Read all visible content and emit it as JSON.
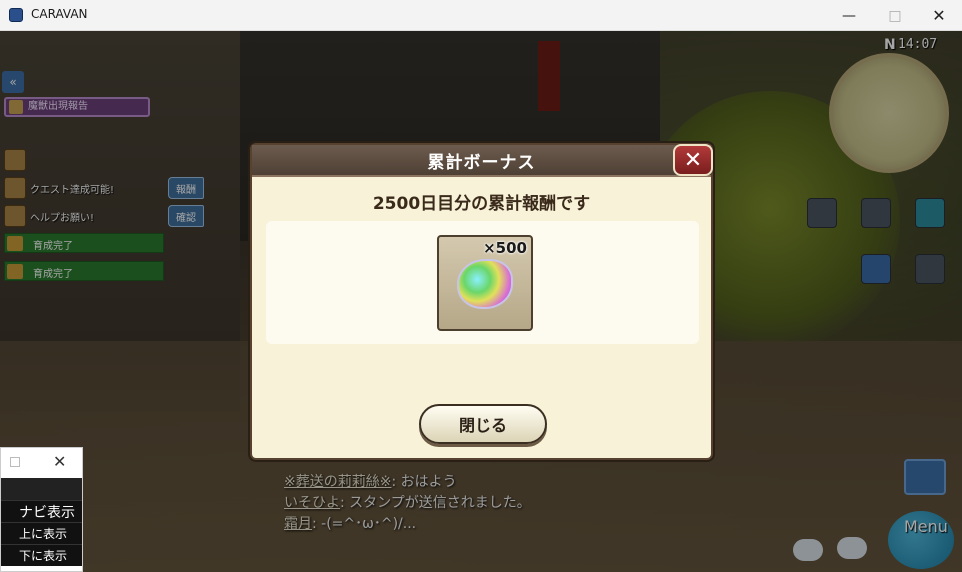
{
  "window": {
    "title": "CARAVAN",
    "controls": {
      "minimize": "—",
      "maximize": "□",
      "close": "✕"
    }
  },
  "hud_left": {
    "collapse_arrow": "«",
    "report_label": "魔獣出現報告",
    "quest_lines": [
      "クエスト達成可能!",
      "ヘルプお願い!"
    ],
    "green_bars": [
      "育成完了",
      "育成完了"
    ],
    "side_tabs": [
      "報酬",
      "確認"
    ]
  },
  "hud_right": {
    "clock": "14:07",
    "compass_letter": "N",
    "menu_label": "Menu"
  },
  "chat": [
    {
      "name": "※葬送の莉莉絲※",
      "text": ": おはよう"
    },
    {
      "name": "いそひよ",
      "text": ": スタンプが送信されました。"
    },
    {
      "name": "霜月",
      "text": ": -(=^･ω･^)/..."
    }
  ],
  "floating_window": {
    "minimize": "□",
    "close": "✕",
    "items": [
      "ナビ表示",
      "上に表示",
      "下に表示"
    ]
  },
  "modal": {
    "title": "累計ボーナス",
    "close": "✕",
    "message": "2500日目分の累計報酬です",
    "reward": {
      "icon": "rainbow-gem-icon",
      "count": "×500"
    },
    "button": "閉じる"
  }
}
